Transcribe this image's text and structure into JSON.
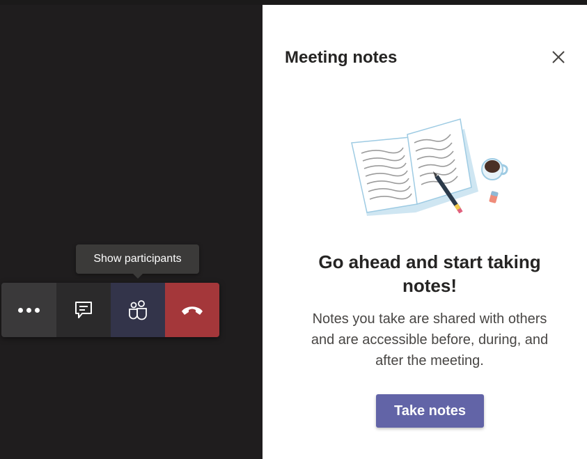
{
  "call_controls": {
    "tooltip": "Show participants",
    "buttons": [
      {
        "name": "more-actions",
        "icon": "ellipsis-icon"
      },
      {
        "name": "chat",
        "icon": "chat-icon"
      },
      {
        "name": "show-participants",
        "icon": "participants-icon"
      },
      {
        "name": "hang-up",
        "icon": "phone-hangup-icon"
      }
    ]
  },
  "notes_panel": {
    "title": "Meeting notes",
    "close_icon": "close-icon",
    "illustration": "notebook-coffee-illustration",
    "headline": "Go ahead and start taking notes!",
    "description": "Notes you take are shared with others and are accessible before, during, and after the meeting.",
    "button_label": "Take notes"
  },
  "colors": {
    "accent": "#6264a7",
    "hangup": "#a4373a",
    "stage_bg": "#1f1d1e",
    "panel_bg": "#ffffff"
  }
}
